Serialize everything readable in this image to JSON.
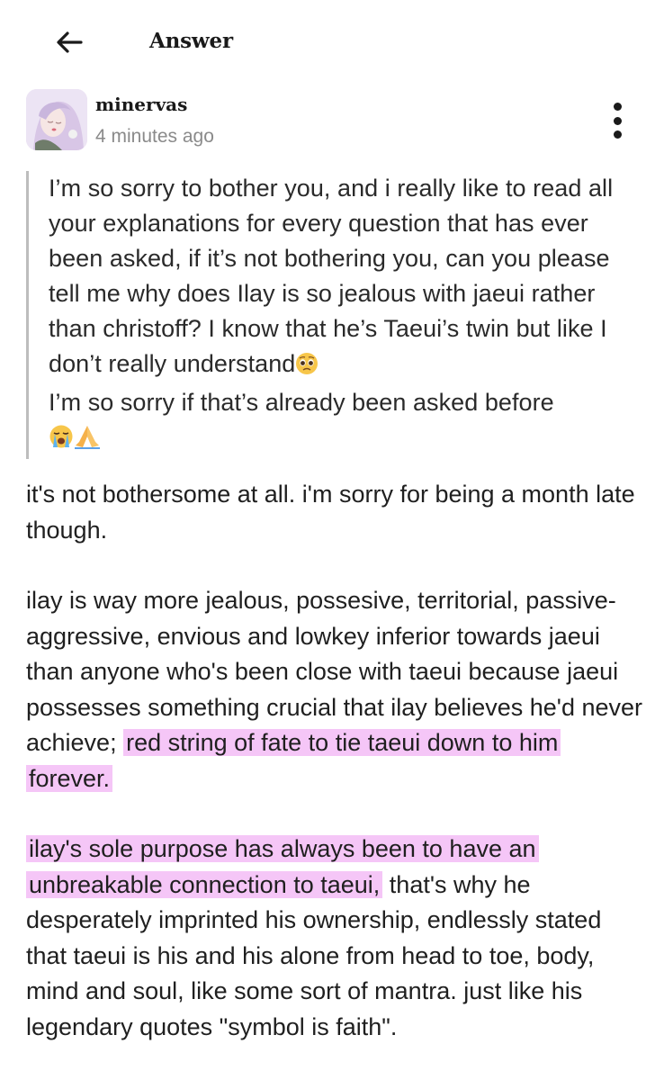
{
  "header": {
    "title": "Answer",
    "back_icon": "arrow-left-icon"
  },
  "post": {
    "username": "minervas",
    "timestamp": "4 minutes ago",
    "more_icon": "more-vertical-icon"
  },
  "question": {
    "text": "I’m so sorry to bother you, and i really like to read all your explanations for every question that has ever been asked, if it’s not bothering you, can you please tell me why does Ilay is so jealous with jaeui rather than christoff? I know that he’s Taeui’s twin but like I don’t really understand",
    "emoji_1": "pleading-face-emoji",
    "text_2": "I’m so sorry if that’s already been asked before",
    "emoji_2": "crying-face-emoji",
    "emoji_3": "folded-hands-emoji"
  },
  "answer": {
    "p1": "it's not bothersome at all. i'm sorry for being a month late though.",
    "p2_plain": "ilay is way more jealous, possesive, territorial, passive-aggressive, envious and lowkey inferior towards jaeui than anyone who's been close with taeui because jaeui possesses something crucial that ilay believes he'd never achieve; ",
    "p2_highlight": "red string of fate to tie taeui down to him forever.",
    "p3_highlight": "ilay's sole purpose has always been to have an unbreakable connection to taeui,",
    "p3_plain": " that's why he desperately imprinted his ownership, endlessly stated that taeui is his and his alone from head to toe, body, mind and soul, like some sort of mantra. just like his legendary quotes \"symbol is faith\"."
  },
  "colors": {
    "highlight": "#f5c6f7",
    "quote_bar": "#bdbdbd",
    "muted_text": "#8a8a8a"
  }
}
